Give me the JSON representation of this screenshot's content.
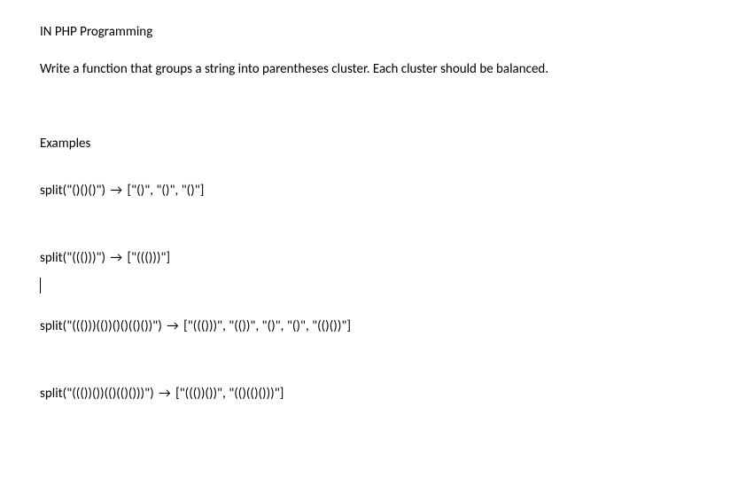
{
  "heading": "IN PHP Programming",
  "description": "Write a function that groups a string into parentheses cluster. Each cluster should be balanced.",
  "examplesLabel": "Examples",
  "arrow": "→",
  "examples": [
    {
      "call": "split(\"()()()\")",
      "result": "[\"()\", \"()\", \"()\"]"
    },
    {
      "call": "split(\"((()))\")",
      "result": "[\"((()))\"]"
    },
    {
      "call": "split(\"((()))(())()()(()())\")",
      "result": "[\"((()))\", \"(())\", \"()\", \"()\", \"(()())\"]"
    },
    {
      "call": "split(\"((())())(()(()()))\")",
      "result": "[\"((())())\", \"(()(()()))\"]"
    }
  ]
}
